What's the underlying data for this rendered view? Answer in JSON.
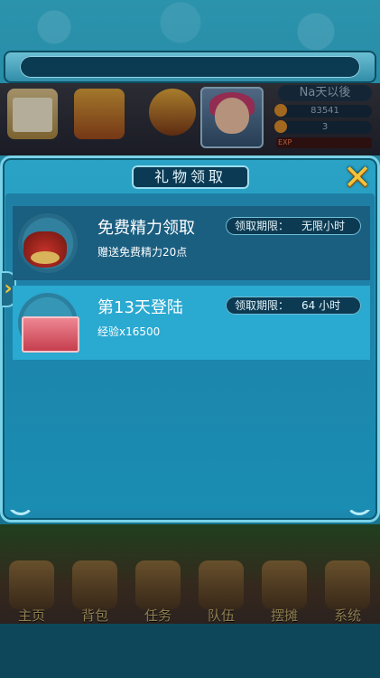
{
  "hud": {
    "player_name": "Na天以後",
    "stat_gold": "83541",
    "stat_second": "3",
    "exp_label": "EXP"
  },
  "panel": {
    "title": "礼物领取",
    "close_icon": "close-x-icon"
  },
  "gifts": [
    {
      "title": "免费精力领取",
      "description": "赠送免费精力20点",
      "deadline_label": "领取期限：",
      "deadline_value": "无限小时",
      "icon": "energy-jar-icon"
    },
    {
      "title": "第13天登陆",
      "description": "经验x16500",
      "deadline_label": "领取期限：",
      "deadline_value": "64  小时",
      "icon": "red-chest-icon"
    }
  ],
  "nav": {
    "items": [
      "主页",
      "背包",
      "任务",
      "队伍",
      "摆摊",
      "系统"
    ]
  }
}
